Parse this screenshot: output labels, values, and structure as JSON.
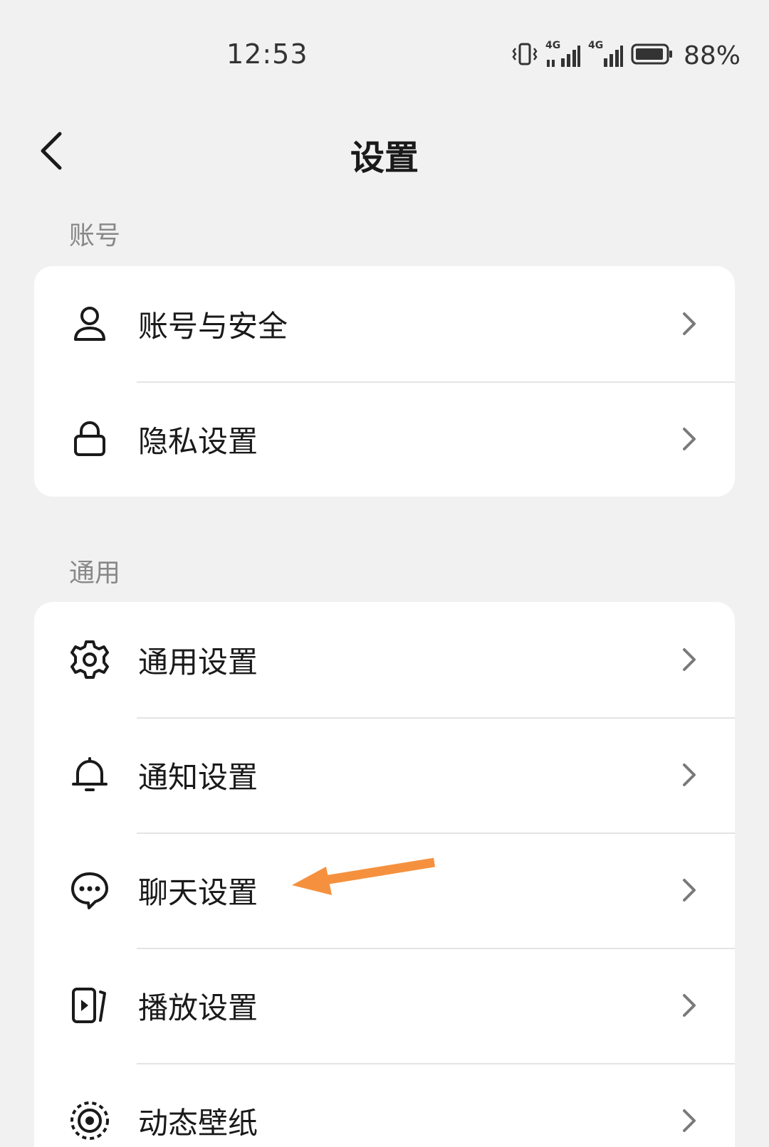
{
  "status_bar": {
    "time": "12:53",
    "battery_percent": "88%",
    "network_1": "4G",
    "network_2": "4G"
  },
  "header": {
    "title": "设置"
  },
  "sections": [
    {
      "label": "账号",
      "items": [
        {
          "label": "账号与安全",
          "icon": "user-icon"
        },
        {
          "label": "隐私设置",
          "icon": "lock-icon"
        }
      ]
    },
    {
      "label": "通用",
      "items": [
        {
          "label": "通用设置",
          "icon": "gear-icon"
        },
        {
          "label": "通知设置",
          "icon": "bell-icon"
        },
        {
          "label": "聊天设置",
          "icon": "chat-icon"
        },
        {
          "label": "播放设置",
          "icon": "play-icon"
        },
        {
          "label": "动态壁纸",
          "icon": "wallpaper-icon"
        }
      ]
    }
  ],
  "colors": {
    "background": "#f1f1f1",
    "card": "#ffffff",
    "annotation_arrow": "#f5913e"
  }
}
